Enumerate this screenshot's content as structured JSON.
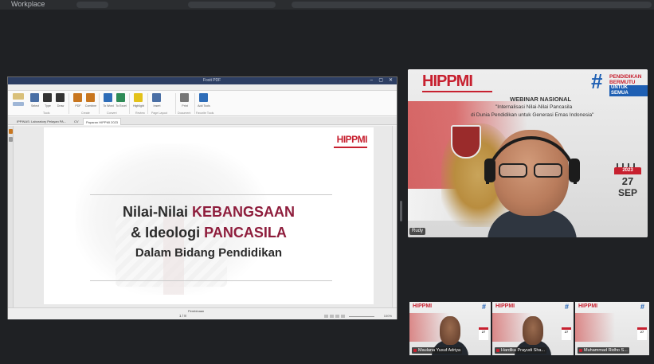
{
  "window": {
    "title": "Workplace"
  },
  "shared_screen": {
    "app_title": "Foxit PDF",
    "window_controls": [
      "–",
      "▢",
      "✕"
    ],
    "menu": [
      "File",
      "Home",
      "Convert",
      "Review",
      "Page Layout",
      "Forms",
      "Share",
      "Extras",
      "Protect",
      "Customize",
      "Help"
    ],
    "ribbon": {
      "buttons": [
        {
          "label": "Select",
          "color": "#4a6fa5"
        },
        {
          "label": "Type",
          "color": "#333333"
        },
        {
          "label": "Draw",
          "color": "#333333"
        },
        {
          "label": "PDF",
          "color": "#c8761f"
        },
        {
          "label": "Combine",
          "color": "#c8761f"
        },
        {
          "label": "To Word",
          "color": "#2e6db8"
        },
        {
          "label": "To Excel",
          "color": "#2e8b57"
        },
        {
          "label": "Highlight",
          "color": "#e3c21a"
        },
        {
          "label": "Insert",
          "color": "#4a6fa5"
        },
        {
          "label": "Print",
          "color": "#777777"
        },
        {
          "label": "Add Tools",
          "color": "#2e6db8"
        }
      ],
      "groups": [
        "Tools",
        "Create",
        "Convert",
        "Review",
        "Page Layout",
        "Document",
        "Favorite Tools"
      ]
    },
    "doc_tabs": [
      "IPPINAS: Laboratory Pelayan PA...",
      "CV",
      "Paparan HIPPMI 2023"
    ],
    "slide": {
      "logo": "HIPPMI",
      "line1_prefix": "Nilai-Nilai ",
      "line1_highlight": "KEBANGSAAN",
      "line2_prefix": "& Ideologi ",
      "line2_highlight": "PANCASILA",
      "line3": "Dalam Bidang Pendidikan"
    },
    "status": {
      "label": "Pembinaan",
      "page": "1 / 8",
      "zoom": "100%"
    }
  },
  "main_speaker": {
    "name": "Rudy",
    "banner": {
      "logo": "HIPPMI",
      "title": "WEBINAR NASIONAL",
      "subtitle1": "\"Internalisasi Nilai-Nilai Pancasila",
      "subtitle2": "di Dunia Pendidikan untuk Generasi Emas Indonesia\"",
      "hashtag": "#",
      "tag1": "PENDIDIKAN",
      "tag2": "BERMUTU",
      "tag3": "UNTUK SEMUA",
      "cal_year": "2023",
      "cal_day": "27",
      "cal_month": "SEP"
    }
  },
  "participants": [
    {
      "name": "Maulana Yusuf Adriya"
    },
    {
      "name": "Hardika Prayudi Sha..."
    },
    {
      "name": "Muhammad Ridho S..."
    }
  ],
  "colors": {
    "brand_red": "#c7202f",
    "brand_blue": "#1e5fb3",
    "slide_highlight": "#8e1d3c",
    "app_bg": "#1f2124"
  }
}
